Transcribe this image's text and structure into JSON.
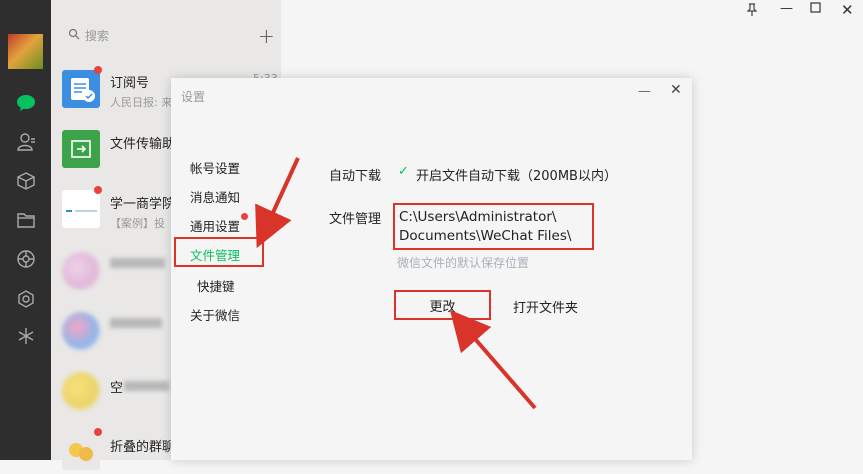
{
  "search": {
    "placeholder": "搜索"
  },
  "chats": [
    {
      "name": "订阅号",
      "preview": "人民日报: 来",
      "time": "5:33"
    },
    {
      "name": "文件传输助"
    },
    {
      "name": "学一商学院",
      "preview": "【案例】投"
    },
    {
      "name": ""
    },
    {
      "name": ""
    },
    {
      "name": "空"
    },
    {
      "name": "折叠的群聊"
    }
  ],
  "settings": {
    "title": "设置",
    "menu": [
      "帐号设置",
      "消息通知",
      "通用设置",
      "文件管理",
      "快捷键",
      "关于微信"
    ],
    "auto_download_label": "自动下载",
    "auto_download_value": "开启文件自动下载（200MB以内）",
    "file_mgmt_label": "文件管理",
    "path_line1": "C:\\Users\\Administrator\\",
    "path_line2": "Documents\\WeChat Files\\",
    "path_hint": "微信文件的默认保存位置",
    "change_button": "更改",
    "open_folder_button": "打开文件夹"
  },
  "colors": {
    "accent_green": "#07c160",
    "highlight_red": "#d8342a",
    "sidebar_dark": "#2e2e2e"
  }
}
